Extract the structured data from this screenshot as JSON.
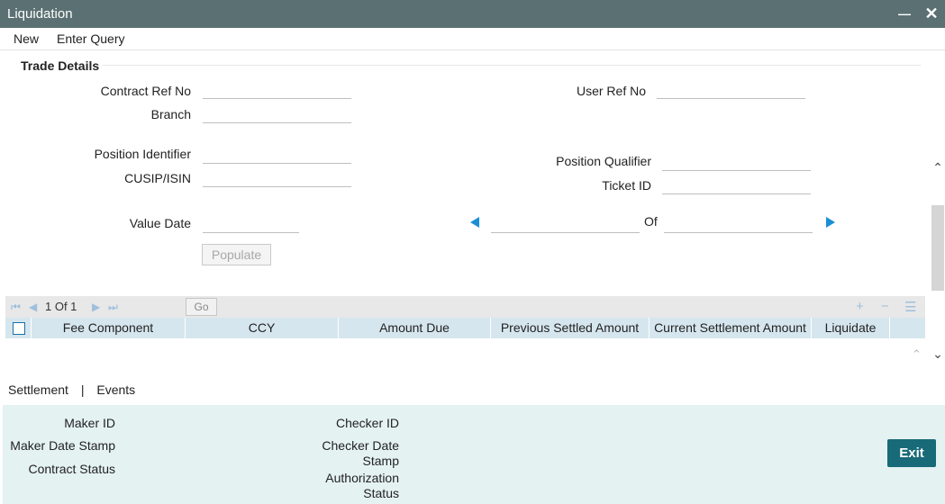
{
  "window": {
    "title": "Liquidation"
  },
  "menu": {
    "new_label": "New",
    "enter_query_label": "Enter Query"
  },
  "trade_details": {
    "section_title": "Trade Details",
    "contract_ref_no_label": "Contract Ref No",
    "branch_label": "Branch",
    "user_ref_no_label": "User Ref No",
    "position_identifier_label": "Position Identifier",
    "cusip_isin_label": "CUSIP/ISIN",
    "position_qualifier_label": "Position Qualifier",
    "ticket_id_label": "Ticket ID",
    "value_date_label": "Value Date",
    "of_label": "Of",
    "populate_label": "Populate",
    "values": {
      "contract_ref_no": "",
      "branch": "",
      "user_ref_no": "",
      "position_identifier": "",
      "cusip_isin": "",
      "position_qualifier": "",
      "ticket_id": "",
      "value_date": "",
      "record_current": "",
      "record_total": ""
    }
  },
  "grid": {
    "pagination_text": "1 Of 1",
    "go_label": "Go",
    "columns": [
      "Fee Component",
      "CCY",
      "Amount Due",
      "Previous Settled Amount",
      "Current Settlement Amount",
      "Liquidate"
    ],
    "rows": []
  },
  "tabs": {
    "settlement_label": "Settlement",
    "separator": "|",
    "events_label": "Events"
  },
  "audit": {
    "maker_id_label": "Maker ID",
    "maker_date_stamp_label": "Maker Date Stamp",
    "contract_status_label": "Contract Status",
    "checker_id_label": "Checker ID",
    "checker_date_stamp_label_1": "Checker Date",
    "checker_date_stamp_label_2": "Stamp",
    "authorization_status_label_1": "Authorization",
    "authorization_status_label_2": "Status"
  },
  "exit_label": "Exit",
  "colors": {
    "titlebar": "#5b7072",
    "accent_arrow": "#1a8fd6",
    "grid_header": "#d6e6ee",
    "footer": "#e5f2f2",
    "exit_button": "#186a78"
  },
  "icons": {
    "minimize": "minimize-icon",
    "close": "close-icon",
    "prev": "arrow-left-icon",
    "next": "arrow-right-icon"
  }
}
